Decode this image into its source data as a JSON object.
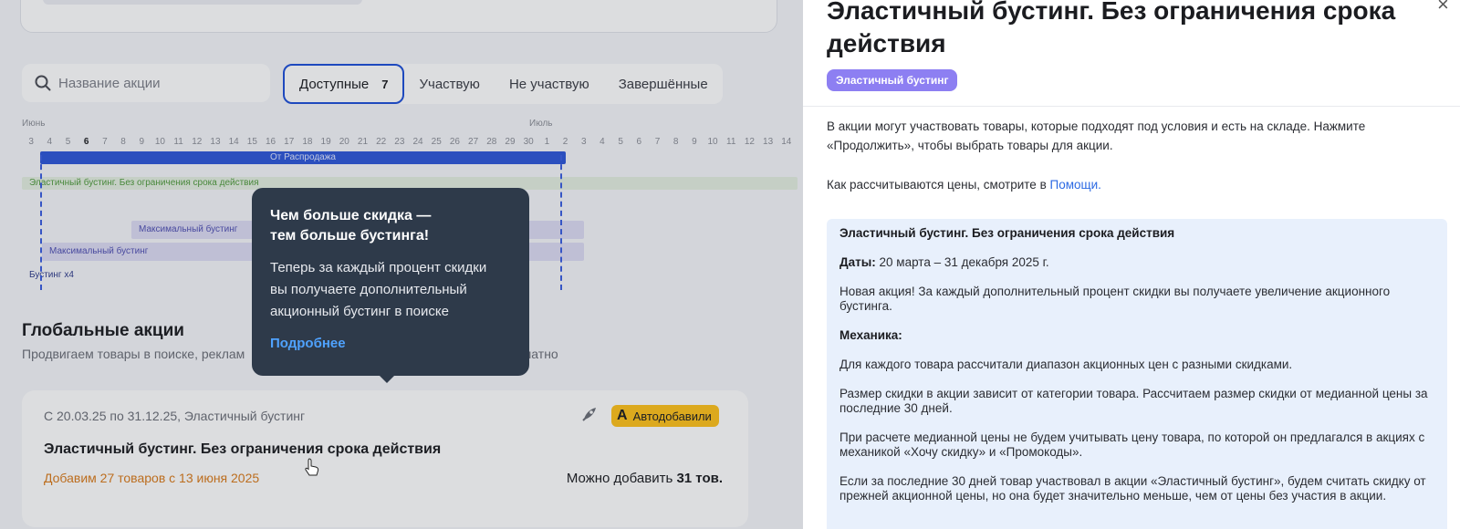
{
  "search": {
    "placeholder": "Название акции"
  },
  "tabs": [
    {
      "label": "Доступные",
      "count": "7",
      "active": true
    },
    {
      "label": "Участвую"
    },
    {
      "label": "Не участвую"
    },
    {
      "label": "Завершённые"
    }
  ],
  "timeline": {
    "month1": "Июнь",
    "month2": "Июль",
    "days": [
      "3",
      "4",
      "5",
      "6",
      "7",
      "8",
      "9",
      "10",
      "11",
      "12",
      "13",
      "14",
      "15",
      "16",
      "17",
      "18",
      "19",
      "20",
      "21",
      "22",
      "23",
      "24",
      "25",
      "26",
      "27",
      "28",
      "29",
      "30",
      "1",
      "2",
      "3",
      "4",
      "5",
      "6",
      "7",
      "8",
      "9",
      "10",
      "11",
      "12",
      "13",
      "14"
    ],
    "today": "6",
    "bars": {
      "sale": "От Распродажа",
      "elastic": "Эластичный бустинг. Без ограничения срока действия",
      "max1": "Максимальный бустинг",
      "max2": "Максимальный бустинг",
      "boost": "Бустинг х4"
    }
  },
  "section": {
    "title": "Глобальные акции",
    "subtitle_left": "Продвигаем товары в поиске, реклам",
    "subtitle_right": "стие бесплатно"
  },
  "promo_card": {
    "dates": "С 20.03.25 по 31.12.25, Эластичный бустинг",
    "badge_letter": "A",
    "badge": "Автодобавили",
    "title": "Эластичный бустинг. Без ограничения срока действия",
    "add_text": "Добавим 27 товаров с 13 июня 2025",
    "can_add_label": "Можно добавить",
    "can_add_value": "31 тов."
  },
  "tooltip": {
    "title": "Чем больше скидка —\nтем больше бустинга!",
    "text": "Теперь за каждый процент скидки\nвы получаете дополнительный\nакционный бустинг в поиске",
    "link": "Подробнее"
  },
  "panel": {
    "title": "Эластичный бустинг. Без ограничения срока действия",
    "close": "×",
    "tag": "Эластичный бустинг",
    "intro": "В акции могут участвовать товары, которые подходят под условия и есть на складе. Нажмите «Продолжить», чтобы выбрать товары для акции.",
    "help_text": "Как рассчитываются цены, смотрите в",
    "help_link": "Помощи.",
    "info": {
      "heading": "Эластичный бустинг. Без ограничения срока действия",
      "dates_label": "Даты:",
      "dates_value": "20 марта – 31 декабря 2025 г.",
      "p1": "Новая акция! За каждый дополнительный процент скидки вы получаете увеличение акционного бустинга.",
      "mechanics_label": "Механика:",
      "p2": "Для каждого товара рассчитали диапазон акционных цен с разными скидками.",
      "p3": "Размер скидки в акции зависит от категории товара. Рассчитаем размер скидки от медианной цены за последние 30 дней.",
      "p4": "При расчете медианной цены не будем учитывать цену товара, по которой он предлагался в акциях с механикой «Хочу скидку» и «Промокоды».",
      "p5": "Если за последние 30 дней товар участвовал в акции «Эластичный бустинг», будем считать скидку от прежней акционной цены, но она будет значительно меньше, чем от цены без участия в акции."
    }
  },
  "colors": {
    "accent_blue": "#1d4fd8",
    "tag_purple": "#8d7ff2",
    "tooltip_bg": "#2e3a4a",
    "badge_yellow": "#ffc21a",
    "add_orange": "#d97a1a",
    "link_blue": "#2d6ae3"
  }
}
